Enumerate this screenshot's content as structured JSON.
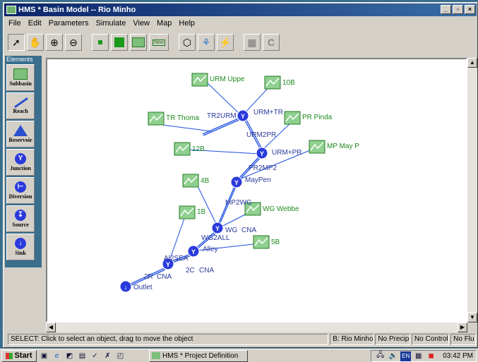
{
  "window": {
    "title": "HMS * Basin Model -- Rio Minho",
    "controls": [
      "_",
      "▫",
      "×"
    ]
  },
  "menu": [
    "File",
    "Edit",
    "Parameters",
    "Simulate",
    "View",
    "Map",
    "Help"
  ],
  "toolbar": {
    "new_label": "New"
  },
  "palette": {
    "header": "Elements",
    "items": [
      "Subbasin",
      "Reach",
      "Reservoir",
      "Junction",
      "Diversion",
      "Source",
      "Sink"
    ]
  },
  "map": {
    "subbasins": {
      "urm_uppe": "URM Uppe",
      "s10b": "10B",
      "tr_thoma": "TR Thoma",
      "pr_pinda": "PR Pinda",
      "s12b": "12B",
      "mp_may_p": "MP May P",
      "s4b": "4B",
      "wg_webbe": "WG Webbe",
      "s1b": "1B",
      "s5b": "5B"
    },
    "junctions": {
      "tr2urm": "TR2URM",
      "urm_tr": "URM+TR",
      "urm2pr": "URM2PR",
      "urm_pr": "URM+PR",
      "pr2mp2": "PR2MP2",
      "maypen": "MayPen",
      "mp2wg": "MP2WG",
      "wg": "WG",
      "cna1": "CNA",
      "wg2all": "WG2ALL",
      "alley": "Alley",
      "al2sea": "Al2SEA",
      "c2": "2C",
      "cna2": "CNA",
      "r2": "2R",
      "cna3": "CNA",
      "outlet": "Outlet"
    }
  },
  "status": {
    "message": "SELECT: Click to select an object, drag to move the object",
    "basin": "B: Rio Minho",
    "precip": "No Precip",
    "control": "No Control",
    "flow": "No Flu"
  },
  "taskbar": {
    "start": "Start",
    "task": "HMS * Project Definition",
    "clock": "03:42 PM"
  },
  "colors": {
    "title_bar": "#0a246a",
    "junction": "#2a3adc",
    "reach": "#1e50e0",
    "label": "#2a3a9a",
    "subbasin_label": "#1e8a1e",
    "desktop": "#3a6e8c"
  }
}
